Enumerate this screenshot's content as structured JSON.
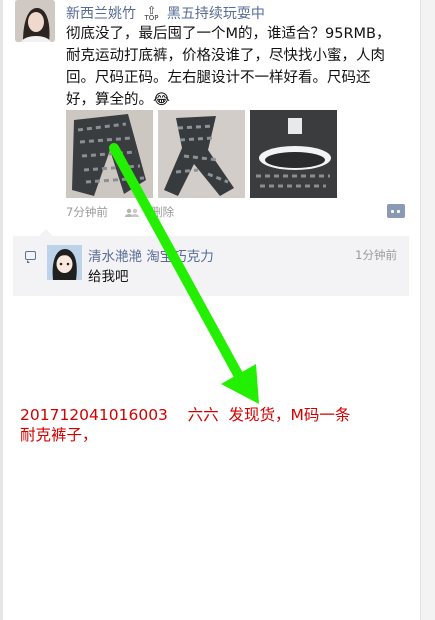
{
  "post": {
    "author": "新西兰姚竹",
    "top_badge": "TOP",
    "feed_title": "黑五持续玩耍中",
    "text": "彻底没了，最后囤了一个M的，谁适合？95RMB，耐克运动打底裤，价格没谁了，尽快找小蜜，人肉回。尺码正码。左右腿设计不一样好看。尺码还好，算全的。😂",
    "time": "7分钟前",
    "delete_label": "删除",
    "photo_icons": [
      "pants-photo-icon",
      "pants-photo-icon",
      "waistband-photo-icon"
    ]
  },
  "comment": {
    "author": "清水滟滟 淘宝巧克力",
    "time": "1分钟前",
    "text": "给我吧"
  },
  "annotation": {
    "line1": "201712041016003    六六  发现货，M码一条",
    "line2": "耐克裤子，"
  },
  "colors": {
    "name_blue": "#576b95",
    "annotation_red": "#d40000",
    "arrow_green": "#22f000"
  }
}
